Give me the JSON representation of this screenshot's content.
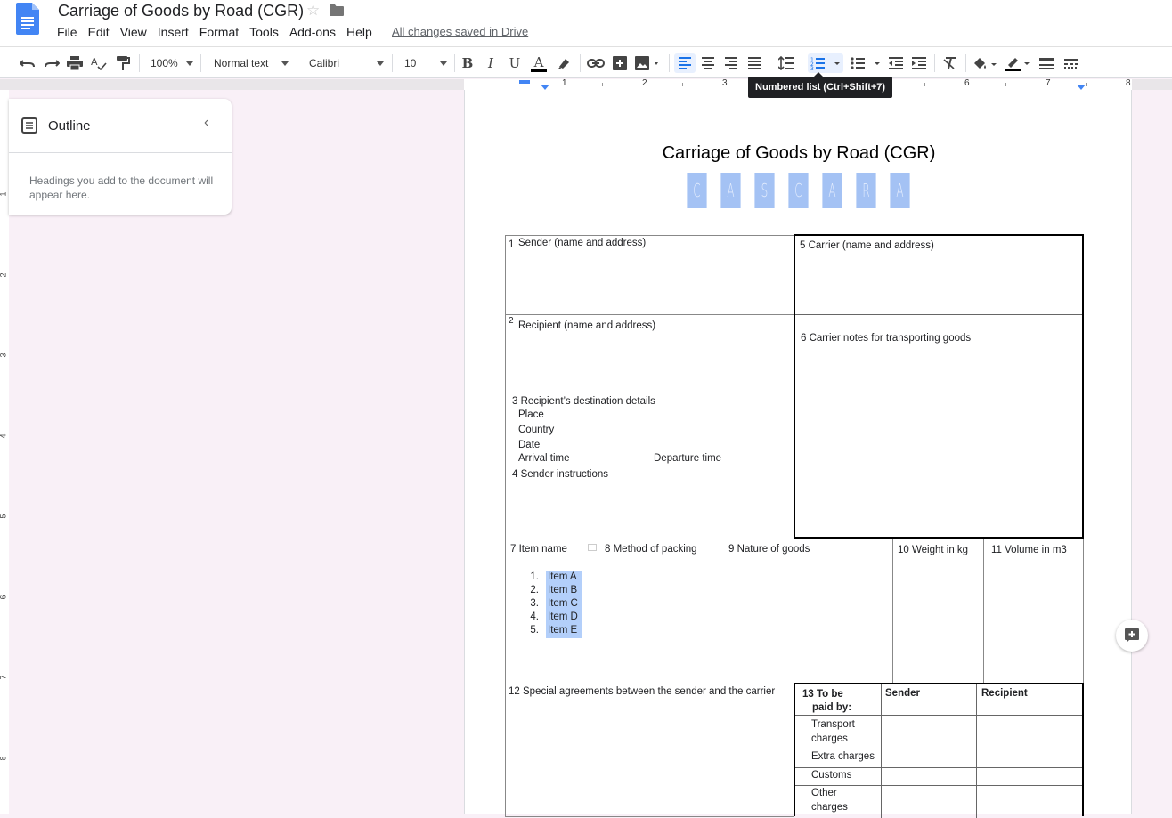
{
  "app": {
    "doc_title": "Carriage of Goods by Road (CGR)",
    "save_status": "All changes saved in Drive",
    "menus": [
      "File",
      "Edit",
      "View",
      "Insert",
      "Format",
      "Tools",
      "Add-ons",
      "Help"
    ]
  },
  "toolbar": {
    "zoom": "100%",
    "style": "Normal text",
    "font": "Calibri",
    "font_size": "10",
    "bold": "B",
    "italic": "I",
    "underline": "U",
    "text_color": "A",
    "tooltip": "Numbered list (Ctrl+Shift+7)",
    "colors": {
      "accent": "#1a73e8",
      "active_bg": "#e8f0fe"
    }
  },
  "ruler": {
    "numbers": [
      "1",
      "2",
      "3",
      "4",
      "5",
      "6",
      "7",
      "8"
    ],
    "vertical_numbers": [
      "1",
      "2",
      "3",
      "4",
      "5",
      "6",
      "7",
      "8"
    ]
  },
  "outline": {
    "title": "Outline",
    "hint": "Headings you add to the document will appear here."
  },
  "document": {
    "title": "Carriage of Goods by Road (CGR)",
    "banner_letters": [
      "C",
      "A",
      "S",
      "C",
      "A",
      "R",
      "A"
    ],
    "banner_color": "#a4c2f4",
    "boxes": {
      "sender": "Sender (name and address)",
      "sender_num": "1",
      "recipient": "Recipient (name and address)",
      "recipient_num": "2",
      "destination": "3 Recipient’s destination details",
      "place": "Place",
      "country": "Country",
      "date": "Date",
      "arrival": "Arrival time",
      "departure": "Departure time",
      "instructions": "4 Sender instructions",
      "carrier": "5 Carrier (name and address)",
      "carrier_notes": "6 Carrier notes for transporting goods",
      "item_name": "7 Item name",
      "packing": "8 Method of packing",
      "nature": "9 Nature of goods",
      "weight": "10 Weight in kg",
      "volume": "11 Volume in m3",
      "special": "12 Special agreements between the sender and the carrier"
    },
    "items": [
      {
        "num": "1.",
        "text": "Item A"
      },
      {
        "num": "2.",
        "text": "Item B"
      },
      {
        "num": "3.",
        "text": "Item C"
      },
      {
        "num": "4.",
        "text": "Item D"
      },
      {
        "num": "5.",
        "text": "Item E"
      }
    ],
    "payment": {
      "head1": "13 To be",
      "head2": "paid by:",
      "col_sender": "Sender",
      "col_recipient": "Recipient",
      "row1a": "Transport",
      "row1b": "charges",
      "row2": "Extra charges",
      "row3": "Customs",
      "row4a": "Other",
      "row4b": "charges"
    }
  }
}
